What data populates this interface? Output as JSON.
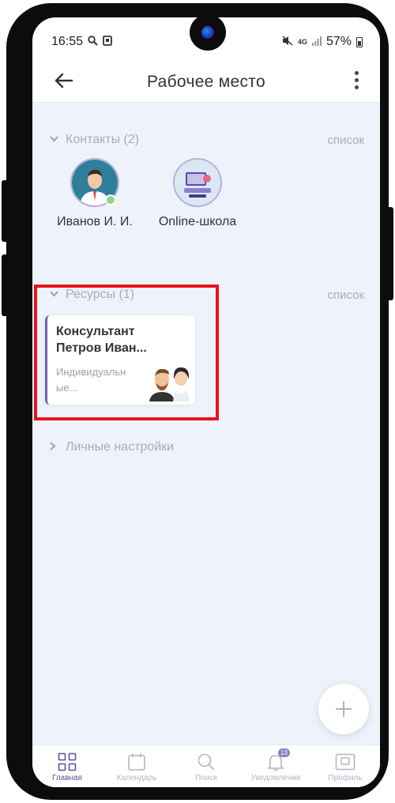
{
  "status_bar": {
    "time": "16:55",
    "network": "4G",
    "battery": "57%"
  },
  "header": {
    "title": "Рабочее место"
  },
  "contacts_section": {
    "title": "Контакты (2)",
    "link": "список",
    "items": [
      {
        "name": "Иванов И. И.",
        "online": true
      },
      {
        "name": "Online-школа",
        "online": false
      }
    ]
  },
  "resources_section": {
    "title": "Ресурсы (1)",
    "link": "список",
    "card": {
      "title": "Консультант Петров Иван...",
      "subtitle": "Индивидуальн ые..."
    }
  },
  "settings_section": {
    "title": "Личные настройки"
  },
  "fab": {
    "icon": "plus-icon"
  },
  "bottom_nav": {
    "items": [
      {
        "label": "Главная",
        "active": true
      },
      {
        "label": "Календарь",
        "active": false
      },
      {
        "label": "Поиск",
        "active": false
      },
      {
        "label": "Уведомления",
        "active": false,
        "badge": "13"
      },
      {
        "label": "Профиль",
        "active": false
      }
    ]
  },
  "colors": {
    "accent": "#5c4f9e",
    "highlight": "#e8141b",
    "background": "#eef3fb",
    "online": "#8ed68e"
  }
}
